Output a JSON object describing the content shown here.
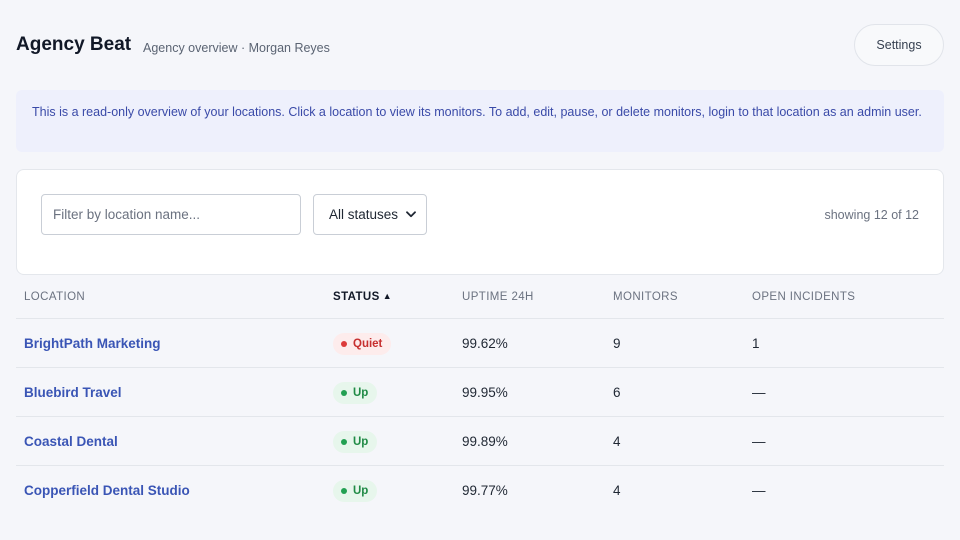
{
  "header": {
    "title": "Agency Beat",
    "subtitle": "Agency overview · Morgan Reyes",
    "settings_label": "Settings"
  },
  "notice": {
    "text": "This is a read-only overview of your locations. Click a location to view its monitors. To add, edit, pause, or delete monitors, login to that location as an admin user."
  },
  "filters": {
    "search_placeholder": "Filter by location name...",
    "search_value": "",
    "status_selected": "All statuses",
    "showing_text": "showing 12 of 12"
  },
  "table": {
    "columns": {
      "location": "LOCATION",
      "status": "STATUS",
      "status_sort": "▲",
      "uptime": "UPTIME 24H",
      "monitors": "MONITORS",
      "incidents": "OPEN INCIDENTS"
    },
    "rows": [
      {
        "location": "BrightPath Marketing",
        "status": "Quiet",
        "status_kind": "quiet",
        "uptime": "99.62%",
        "monitors": "9",
        "incidents": "1"
      },
      {
        "location": "Bluebird Travel",
        "status": "Up",
        "status_kind": "up",
        "uptime": "99.95%",
        "monitors": "6",
        "incidents": "—"
      },
      {
        "location": "Coastal Dental",
        "status": "Up",
        "status_kind": "up",
        "uptime": "99.89%",
        "monitors": "4",
        "incidents": "—"
      },
      {
        "location": "Copperfield Dental Studio",
        "status": "Up",
        "status_kind": "up",
        "uptime": "99.77%",
        "monitors": "4",
        "incidents": "—"
      }
    ]
  },
  "colors": {
    "accent_link": "#3a55b5",
    "notice_bg": "#eef0fc",
    "status_quiet": "#dc3a3a",
    "status_up": "#22a052"
  }
}
